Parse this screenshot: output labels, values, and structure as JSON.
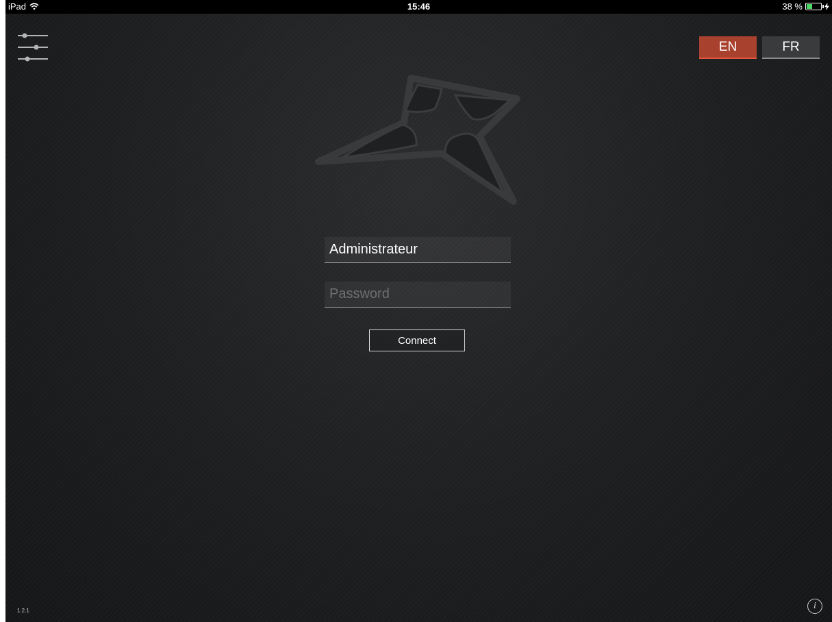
{
  "statusbar": {
    "device": "iPad",
    "wifi_icon": "wifi-icon",
    "time": "15:46",
    "battery_text": "38 %",
    "battery_level": 0.38,
    "battery_icon": "battery-charging-icon",
    "battery_color": "#4cd964"
  },
  "toolbar": {
    "settings_icon": "sliders-icon"
  },
  "language": {
    "options": [
      {
        "code": "EN",
        "active": true
      },
      {
        "code": "FR",
        "active": false
      }
    ],
    "active_color": "#a9412f"
  },
  "logo": {
    "icon": "star-logo-icon"
  },
  "login": {
    "username_value": "Administrateur",
    "password_placeholder": "Password",
    "connect_label": "Connect"
  },
  "footer": {
    "version": "1.2.1",
    "info_icon": "info-icon"
  }
}
